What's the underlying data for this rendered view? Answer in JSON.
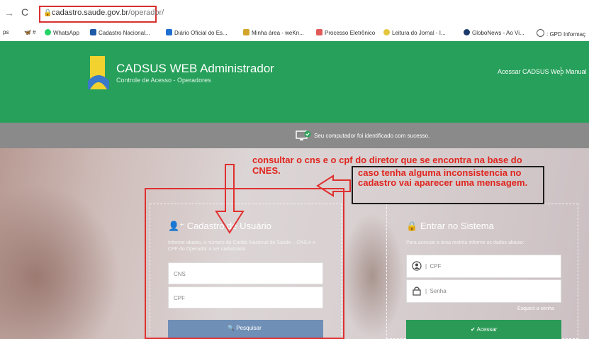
{
  "browser": {
    "url_domain": "cadastro.saude.gov.br",
    "url_path": "/operador/",
    "bookmarks": [
      "ps",
      "WhatsApp",
      "Cadastro Nacional...",
      "Diário Oficial do Es...",
      "Minha área - weKn...",
      "Processo Eletrônico",
      "Leitura do Jornal - I...",
      "GloboNews - Ao Vi...",
      ": GPD Informaç"
    ]
  },
  "header": {
    "title": "CADSUS WEB Administrador",
    "subtitle": "Controle de Acesso - Operadores",
    "link_acessar": "Acessar CADSUS Web",
    "link_manual": "Manual"
  },
  "notice": {
    "text": "Seu computador foi identificado com sucesso."
  },
  "cadastro": {
    "title": "Cadastro de Usuário",
    "description": "Informe abaixo, o número do Cartão Nacional de Saúde – CNS e o CPF do Operador a ser cadastrado",
    "cns_placeholder": "CNS",
    "cpf_placeholder": "CPF",
    "button": "Pesquisar"
  },
  "login": {
    "title": "Entrar no Sistema",
    "description": "Para acessar a área restrita informe os dados abaixo:",
    "cpf_placeholder": "CPF",
    "senha_placeholder": "Senha",
    "forgot": "Esqueci a senha",
    "button": "Acessar"
  },
  "annotations": {
    "note1": "consultar o cns e o cpf do diretor que se encontra na base do CNES.",
    "note2": "caso tenha alguma inconsistencia no cadastro vai aparecer uma mensagem."
  }
}
